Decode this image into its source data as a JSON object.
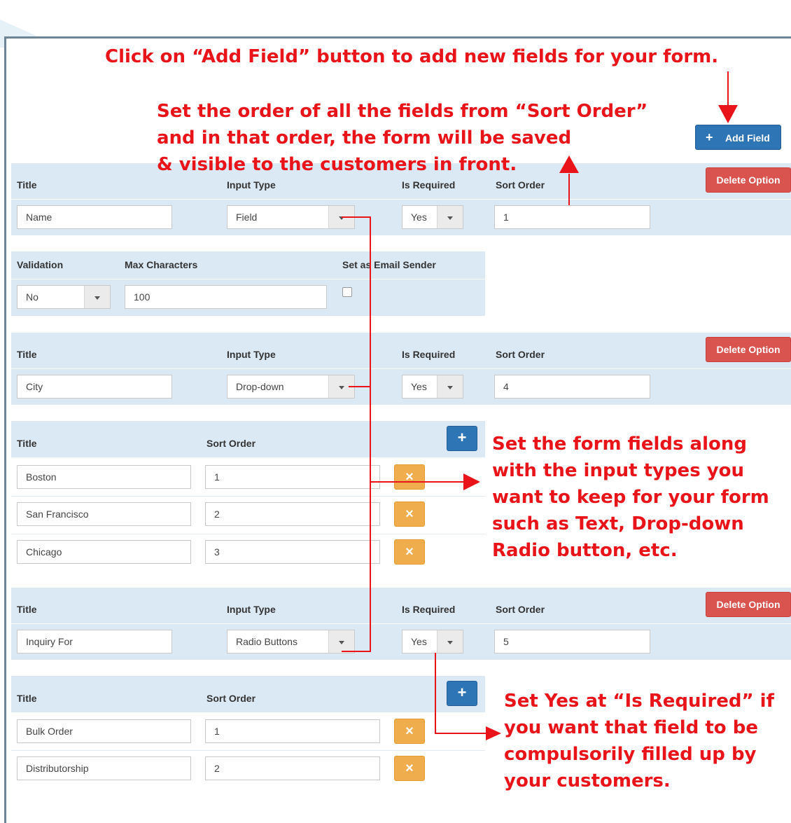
{
  "buttons": {
    "add_field": "Add Field",
    "delete_option": "Delete Option",
    "plus": "+",
    "remove": "×"
  },
  "section1": {
    "headers": {
      "title": "Title",
      "input_type": "Input Type",
      "is_required": "Is Required",
      "sort_order": "Sort Order"
    },
    "title_value": "Name",
    "input_type_value": "Field",
    "is_required_value": "Yes",
    "sort_order_value": "1"
  },
  "section1_extra": {
    "headers": {
      "validation": "Validation",
      "max_characters": "Max Characters",
      "email_sender": "Set as Email Sender"
    },
    "validation_value": "No",
    "max_characters_value": "100",
    "email_sender_checked": false
  },
  "section2": {
    "headers": {
      "title": "Title",
      "input_type": "Input Type",
      "is_required": "Is Required",
      "sort_order": "Sort Order"
    },
    "title_value": "City",
    "input_type_value": "Drop-down",
    "is_required_value": "Yes",
    "sort_order_value": "4",
    "options_headers": {
      "title": "Title",
      "sort_order": "Sort Order"
    },
    "options": [
      {
        "title": "Boston",
        "sort_order": "1"
      },
      {
        "title": "San Francisco",
        "sort_order": "2"
      },
      {
        "title": "Chicago",
        "sort_order": "3"
      }
    ]
  },
  "section3": {
    "headers": {
      "title": "Title",
      "input_type": "Input Type",
      "is_required": "Is Required",
      "sort_order": "Sort Order"
    },
    "title_value": "Inquiry For",
    "input_type_value": "Radio Buttons",
    "is_required_value": "Yes",
    "sort_order_value": "5",
    "options_headers": {
      "title": "Title",
      "sort_order": "Sort Order"
    },
    "options": [
      {
        "title": "Bulk Order",
        "sort_order": "1"
      },
      {
        "title": "Distributorship",
        "sort_order": "2"
      }
    ]
  },
  "annotations": {
    "add_field": "Click on “Add Field” button to add new fields for your form.",
    "sort_order": [
      "Set the order of all the fields from “Sort Order”",
      "and in that order, the form will be saved",
      "& visible to the customers in front."
    ],
    "input_types": [
      "Set the form fields along",
      "with the input types you",
      "want to keep for your form",
      "such as Text, Drop-down",
      "Radio button, etc."
    ],
    "is_required": [
      "Set Yes at “Is Required” if",
      "you want that field to be",
      "compulsorily filled up by",
      "your customers."
    ]
  },
  "colors": {
    "annotation": "#e8141a",
    "band": "#dbe9f4",
    "primary": "#2e75b6",
    "danger": "#d9534f",
    "warning": "#f0ad4e"
  }
}
